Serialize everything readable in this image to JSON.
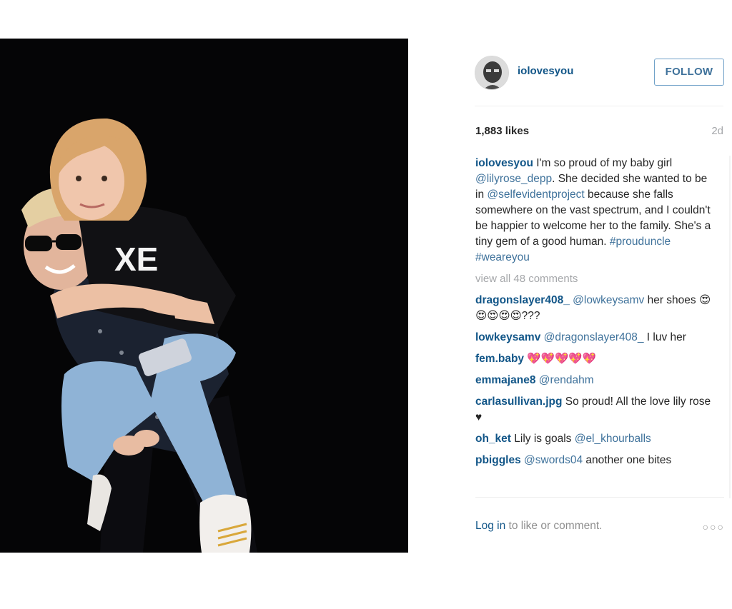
{
  "header": {
    "username": "iolovesyou",
    "follow_label": "FOLLOW",
    "avatar_icon": "profile-avatar-icon"
  },
  "stats": {
    "likes": "1,883 likes",
    "age": "2d"
  },
  "caption": {
    "user": "iolovesyou",
    "parts": [
      {
        "text": " I'm so proud of my baby girl ",
        "type": "text"
      },
      {
        "text": "@lilyrose_depp",
        "type": "mention"
      },
      {
        "text": ". She decided she wanted to be in ",
        "type": "text"
      },
      {
        "text": "@selfevidentproject",
        "type": "mention"
      },
      {
        "text": " because she falls somewhere on the vast spectrum, and I couldn't be happier to welcome her to the family. She's a tiny gem of a good human. ",
        "type": "text"
      },
      {
        "text": "#prouduncle",
        "type": "mention"
      },
      {
        "text": " ",
        "type": "text"
      },
      {
        "text": "#weareyou",
        "type": "mention"
      }
    ]
  },
  "view_all": "view all 48 comments",
  "comments": [
    {
      "user": "dragonslayer408_",
      "parts": [
        {
          "text": " ",
          "type": "text"
        },
        {
          "text": "@lowkeysamv",
          "type": "mention"
        },
        {
          "text": " her shoes 😍😍😍😍😍???",
          "type": "text"
        }
      ]
    },
    {
      "user": "lowkeysamv",
      "parts": [
        {
          "text": " ",
          "type": "text"
        },
        {
          "text": "@dragonslayer408_",
          "type": "mention"
        },
        {
          "text": " I luv her",
          "type": "text"
        }
      ]
    },
    {
      "user": "fem.baby",
      "parts": [
        {
          "text": " 💖💖💖💖💖",
          "type": "text"
        }
      ]
    },
    {
      "user": "emmajane8",
      "parts": [
        {
          "text": " ",
          "type": "text"
        },
        {
          "text": "@rendahm",
          "type": "mention"
        }
      ]
    },
    {
      "user": "carlasullivan.jpg",
      "parts": [
        {
          "text": " So proud! All the love lily rose ♥",
          "type": "text"
        }
      ]
    },
    {
      "user": "oh_ket",
      "parts": [
        {
          "text": " Lily is goals ",
          "type": "text"
        },
        {
          "text": "@el_khourballs",
          "type": "mention"
        }
      ]
    },
    {
      "user": "pbiggles",
      "parts": [
        {
          "text": " ",
          "type": "text"
        },
        {
          "text": "@swords04",
          "type": "mention"
        },
        {
          "text": " another one bites",
          "type": "text"
        }
      ]
    }
  ],
  "footer": {
    "login_link": "Log in",
    "login_rest": " to like or comment.",
    "more_icon": "more-options-icon",
    "more_glyph": "○○○"
  },
  "colors": {
    "link": "#125688",
    "mention": "#3f729b",
    "muted": "#a5a7aa",
    "photo_bg": "#050506"
  }
}
